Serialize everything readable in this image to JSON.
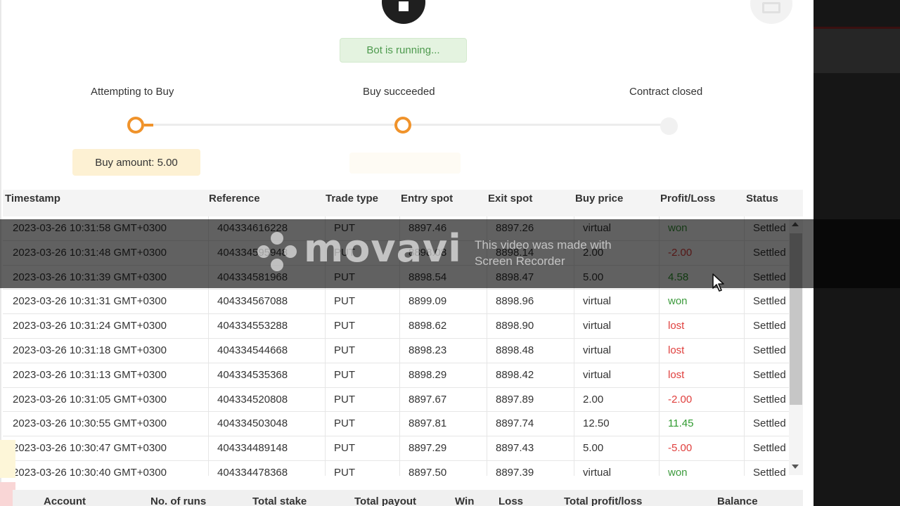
{
  "bot_status": "Bot is running...",
  "steps": [
    {
      "label": "Attempting to Buy"
    },
    {
      "label": "Buy succeeded"
    },
    {
      "label": "Contract closed"
    }
  ],
  "buy_amount": "Buy amount: 5.00",
  "table": {
    "columns": [
      "Timestamp",
      "Reference",
      "Trade type",
      "Entry spot",
      "Exit spot",
      "Buy price",
      "Profit/Loss",
      "Status"
    ],
    "rows": [
      {
        "timestamp": "2023-03-26 10:31:58 GMT+0300",
        "reference": "404334616228",
        "trade_type": "PUT",
        "entry_spot": "8897.46",
        "exit_spot": "8897.26",
        "buy_price": "virtual",
        "profit_loss": "won",
        "status": "Settled"
      },
      {
        "timestamp": "2023-03-26 10:31:48 GMT+0300",
        "reference": "404334595948",
        "trade_type": "PUT",
        "entry_spot": "8898.08",
        "exit_spot": "8898.14",
        "buy_price": "2.00",
        "profit_loss": "-2.00",
        "status": "Settled"
      },
      {
        "timestamp": "2023-03-26 10:31:39 GMT+0300",
        "reference": "404334581968",
        "trade_type": "PUT",
        "entry_spot": "8898.54",
        "exit_spot": "8898.47",
        "buy_price": "5.00",
        "profit_loss": "4.58",
        "status": "Settled"
      },
      {
        "timestamp": "2023-03-26 10:31:31 GMT+0300",
        "reference": "404334567088",
        "trade_type": "PUT",
        "entry_spot": "8899.09",
        "exit_spot": "8898.96",
        "buy_price": "virtual",
        "profit_loss": "won",
        "status": "Settled"
      },
      {
        "timestamp": "2023-03-26 10:31:24 GMT+0300",
        "reference": "404334553288",
        "trade_type": "PUT",
        "entry_spot": "8898.62",
        "exit_spot": "8898.90",
        "buy_price": "virtual",
        "profit_loss": "lost",
        "status": "Settled"
      },
      {
        "timestamp": "2023-03-26 10:31:18 GMT+0300",
        "reference": "404334544668",
        "trade_type": "PUT",
        "entry_spot": "8898.23",
        "exit_spot": "8898.48",
        "buy_price": "virtual",
        "profit_loss": "lost",
        "status": "Settled"
      },
      {
        "timestamp": "2023-03-26 10:31:13 GMT+0300",
        "reference": "404334535368",
        "trade_type": "PUT",
        "entry_spot": "8898.29",
        "exit_spot": "8898.42",
        "buy_price": "virtual",
        "profit_loss": "lost",
        "status": "Settled"
      },
      {
        "timestamp": "2023-03-26 10:31:05 GMT+0300",
        "reference": "404334520808",
        "trade_type": "PUT",
        "entry_spot": "8897.67",
        "exit_spot": "8897.89",
        "buy_price": "2.00",
        "profit_loss": "-2.00",
        "status": "Settled"
      },
      {
        "timestamp": "2023-03-26 10:30:55 GMT+0300",
        "reference": "404334503048",
        "trade_type": "PUT",
        "entry_spot": "8897.81",
        "exit_spot": "8897.74",
        "buy_price": "12.50",
        "profit_loss": "11.45",
        "status": "Settled"
      },
      {
        "timestamp": "2023-03-26 10:30:47 GMT+0300",
        "reference": "404334489148",
        "trade_type": "PUT",
        "entry_spot": "8897.29",
        "exit_spot": "8897.43",
        "buy_price": "5.00",
        "profit_loss": "-5.00",
        "status": "Settled"
      },
      {
        "timestamp": "2023-03-26 10:30:40 GMT+0300",
        "reference": "404334478368",
        "trade_type": "PUT",
        "entry_spot": "8897.50",
        "exit_spot": "8897.39",
        "buy_price": "virtual",
        "profit_loss": "won",
        "status": "Settled"
      }
    ]
  },
  "summary": {
    "columns": [
      "Account",
      "No. of runs",
      "Total stake",
      "Total payout",
      "Win",
      "Loss",
      "Total profit/loss",
      "Balance"
    ]
  },
  "watermark": {
    "brand": "movavi",
    "line1": "This video was made with",
    "line2": "Screen Recorder"
  },
  "colors": {
    "accent_orange": "#f0932b",
    "running_green": "#4e9a4e",
    "won_green": "#3c9a3c",
    "lost_red": "#e0403e"
  },
  "icons": [
    "stop-icon",
    "layout-toggle-icon",
    "scroll-up-icon",
    "scroll-down-icon",
    "cursor-icon"
  ]
}
